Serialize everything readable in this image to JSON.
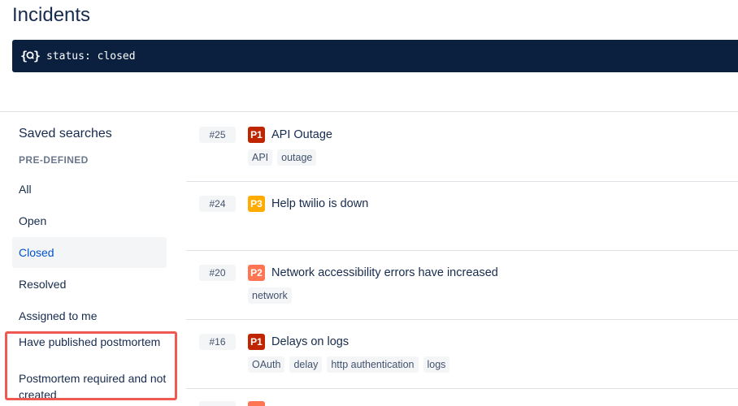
{
  "page": {
    "title": "Incidents"
  },
  "search": {
    "icon": "search-query-icon",
    "value": "status: closed"
  },
  "sidebar": {
    "title": "Saved searches",
    "section_label": "PRE-DEFINED",
    "items": [
      {
        "label": "All"
      },
      {
        "label": "Open"
      },
      {
        "label": "Closed",
        "selected": true
      },
      {
        "label": "Resolved"
      },
      {
        "label": "Assigned to me"
      },
      {
        "label": "Have published postmortem"
      },
      {
        "label": "Postmortem required and not created"
      }
    ]
  },
  "colors": {
    "P1": "#bf2600",
    "P2": "#ff7452",
    "P3": "#ffab00",
    "selected_text": "#0052cc",
    "highlight": "#ee5a52"
  },
  "incidents": [
    {
      "number": "#25",
      "priority": "P1",
      "title": "API Outage",
      "tags": [
        "API",
        "outage"
      ]
    },
    {
      "number": "#24",
      "priority": "P3",
      "title": "Help twilio is down",
      "tags": []
    },
    {
      "number": "#20",
      "priority": "P2",
      "title": "Network accessibility errors have increased",
      "tags": [
        "network"
      ]
    },
    {
      "number": "#16",
      "priority": "P1",
      "title": "Delays on logs",
      "tags": [
        "OAuth",
        "delay",
        "http authentication",
        "logs"
      ]
    }
  ]
}
